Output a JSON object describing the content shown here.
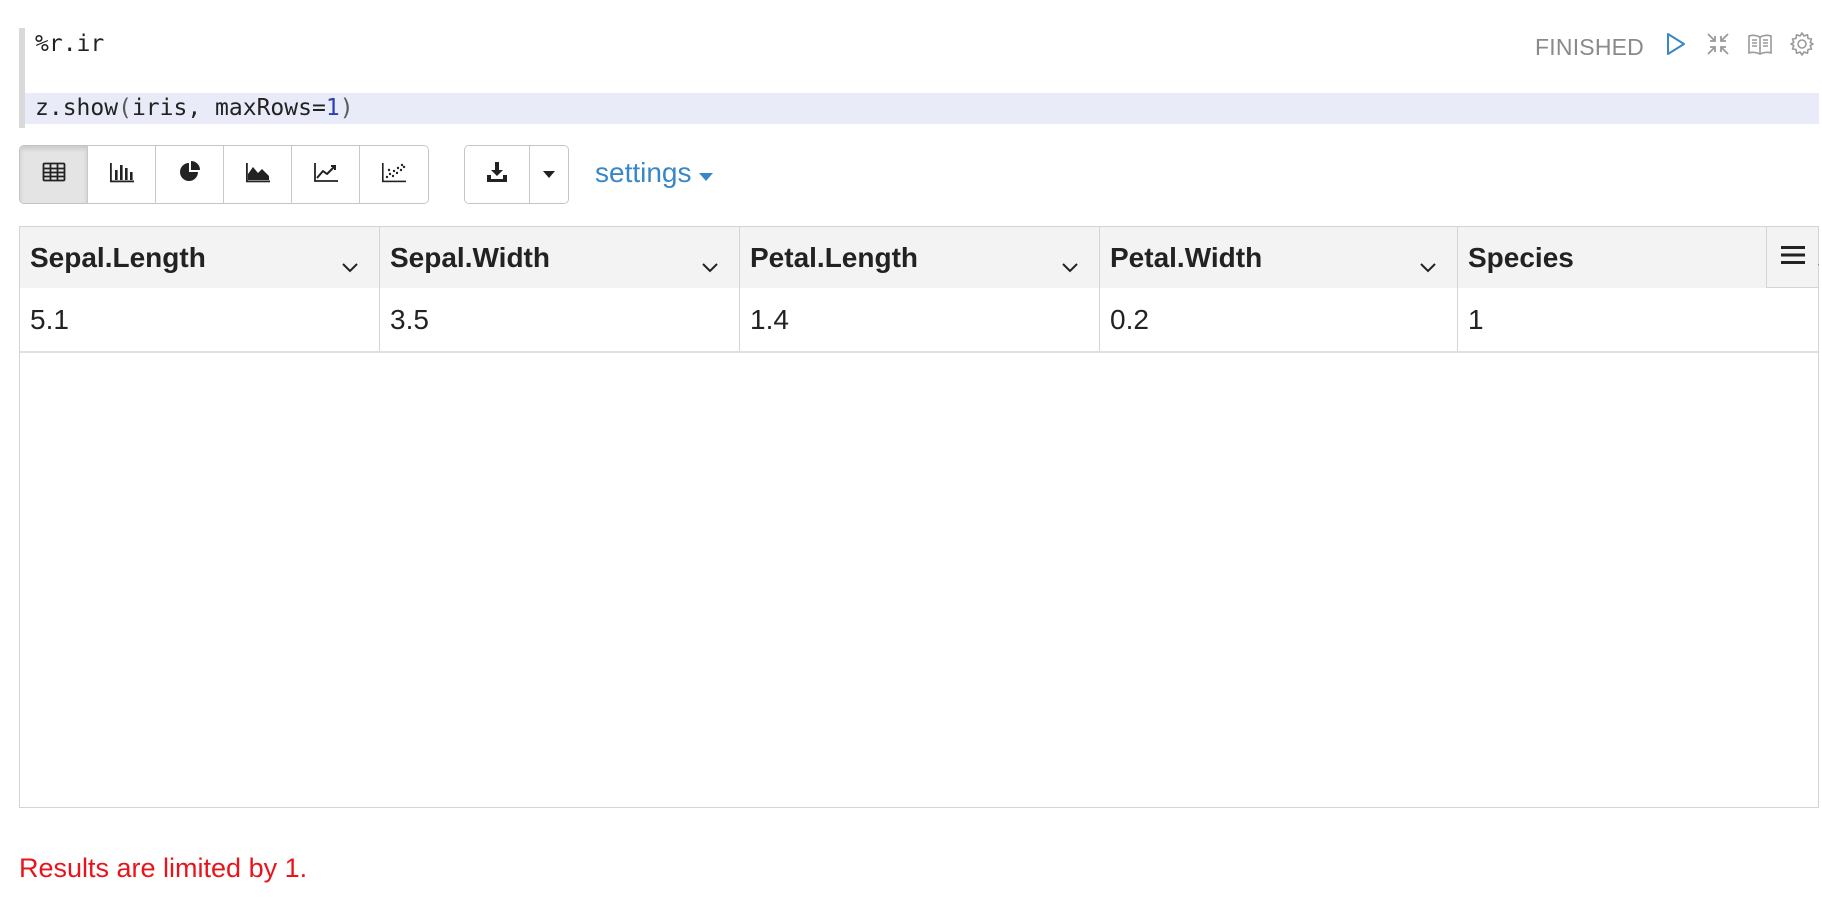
{
  "editor": {
    "line1": "%r.ir",
    "line2": {
      "fn": "z.show",
      "open": "(",
      "args": "iris, maxRows=",
      "num": "1",
      "close": ")"
    }
  },
  "paragraph": {
    "status": "FINISHED",
    "icons": [
      "run-icon",
      "collapse-icon",
      "book-icon",
      "gear-icon"
    ]
  },
  "toolbar": {
    "viz_buttons": [
      "table-icon",
      "bar-chart-icon",
      "pie-chart-icon",
      "area-chart-icon",
      "line-chart-icon",
      "scatter-chart-icon"
    ],
    "active": "table-icon",
    "download_icon": "download-icon",
    "settings_label": "settings"
  },
  "table": {
    "columns": [
      "Sepal.Length",
      "Sepal.Width",
      "Petal.Length",
      "Petal.Width",
      "Species"
    ],
    "rows": [
      [
        "5.1",
        "3.5",
        "1.4",
        "0.2",
        "1"
      ]
    ]
  },
  "footer": {
    "limit_message": "Results are limited by 1."
  },
  "colors": {
    "accent": "#3a87c8",
    "warning": "#e8141b",
    "status": "#8a8a8a",
    "highlight_line": "#e9ecf8"
  }
}
